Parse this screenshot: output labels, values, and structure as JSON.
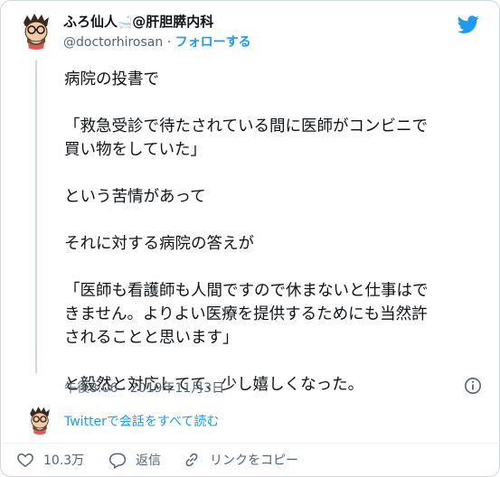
{
  "author": {
    "display_name": "ふろ仙人",
    "bath_emoji": "🛁",
    "affiliation": "@肝胆膵内科",
    "handle": "@doctorhirosan",
    "separator": " · ",
    "follow_label": "フォローする"
  },
  "tweet": {
    "paragraphs": [
      "病院の投書で",
      "「救急受診で待たされている間に医師がコンビニで\n買い物をしていた」",
      "という苦情があって",
      "それに対する病院の答えが",
      "「医師も看護師も人間ですので休まないと仕事はで\nきません。よりよい医療を提供するためにも当然許\nされることと思います」",
      "と毅然と対応してて、少し嬉しくなった。"
    ],
    "timestamp": "午後8:06 · 2019年11月3日"
  },
  "conversation": {
    "link_label": "Twitterで会話をすべて読む"
  },
  "actions": {
    "like_count": "10.3万",
    "reply_label": "返信",
    "copy_link_label": "リンクをコピー"
  },
  "icons": {
    "brand": "twitter-bird-icon",
    "info": "info-icon",
    "like": "heart-icon",
    "reply": "speech-bubble-icon",
    "copy": "link-icon"
  },
  "colors": {
    "accent": "#1d9bf0",
    "muted": "#536471",
    "text": "#0f1419",
    "border": "#cfd9de"
  }
}
